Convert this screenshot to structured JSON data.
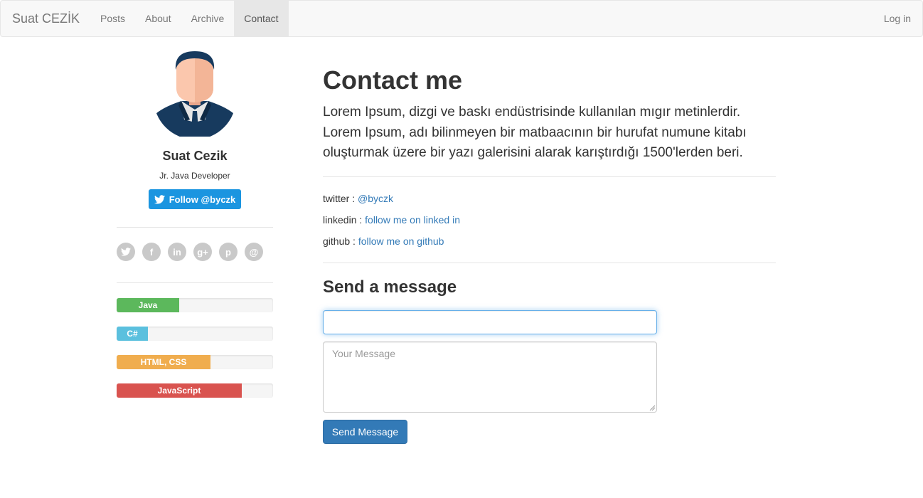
{
  "navbar": {
    "brand": "Suat CEZİK",
    "items": [
      {
        "label": "Posts"
      },
      {
        "label": "About"
      },
      {
        "label": "Archive"
      },
      {
        "label": "Contact",
        "active": true
      }
    ],
    "login": "Log in"
  },
  "sidebar": {
    "name": "Suat Cezik",
    "role": "Jr. Java Developer",
    "follow_label": "Follow @byczk",
    "socials": [
      {
        "icon": "twitter-icon",
        "glyph": "t"
      },
      {
        "icon": "facebook-icon",
        "glyph": "f"
      },
      {
        "icon": "linkedin-icon",
        "glyph": "in"
      },
      {
        "icon": "google-plus-icon",
        "glyph": "g+"
      },
      {
        "icon": "pinterest-icon",
        "glyph": "p"
      },
      {
        "icon": "email-icon",
        "glyph": "@"
      }
    ],
    "skills": [
      {
        "label": "Java",
        "percent": 40,
        "color": "#5cb85c"
      },
      {
        "label": "C#",
        "percent": 20,
        "color": "#5bc0de"
      },
      {
        "label": "HTML, CSS",
        "percent": 60,
        "color": "#f0ad4e"
      },
      {
        "label": "JavaScript",
        "percent": 80,
        "color": "#d9534f"
      }
    ]
  },
  "main": {
    "title": "Contact me",
    "lead": "Lorem Ipsum, dizgi ve baskı endüstrisinde kullanılan mıgır metinlerdir. Lorem Ipsum, adı bilinmeyen bir matbaacının bir hurufat numune kitabı oluşturmak üzere bir yazı galerisini alarak karıştırdığı 1500'lerden beri.",
    "contacts": [
      {
        "label": "twitter : ",
        "link": "@byczk"
      },
      {
        "label": "linkedin : ",
        "link": "follow me on linked in"
      },
      {
        "label": "github : ",
        "link": "follow me on github"
      }
    ],
    "form": {
      "title": "Send a message",
      "input_value": "",
      "message_placeholder": "Your Message",
      "send_label": "Send Message"
    }
  }
}
